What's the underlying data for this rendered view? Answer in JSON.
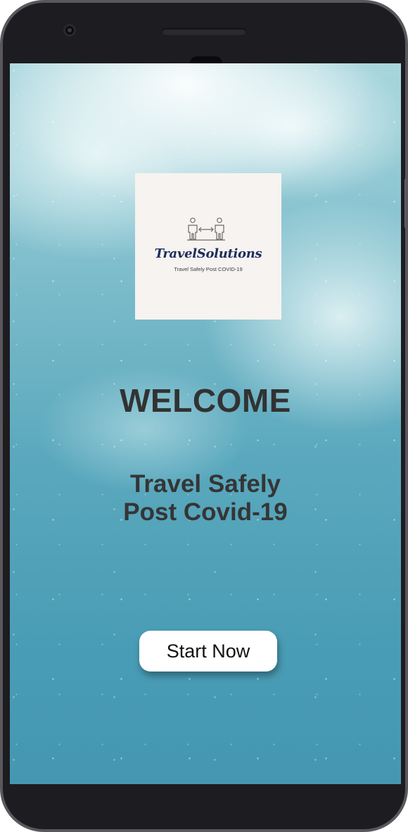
{
  "logo": {
    "brand_name": "TravelSolutions",
    "tagline": "Travel Safely Post COVID-19",
    "icon": "social-distancing-people-icon"
  },
  "welcome": {
    "heading": "WELCOME",
    "subtitle_line1": "Travel Safely",
    "subtitle_line2": "Post Covid-19"
  },
  "actions": {
    "start_label": "Start Now"
  },
  "colors": {
    "phone_bezel": "#1d1c20",
    "sky_top": "#a9d6dd",
    "sky_bottom": "#4597b1",
    "logo_bg": "#f6f3f0",
    "brand_text": "#1d2d5c",
    "heading_text": "#323232",
    "button_bg": "#ffffff"
  }
}
